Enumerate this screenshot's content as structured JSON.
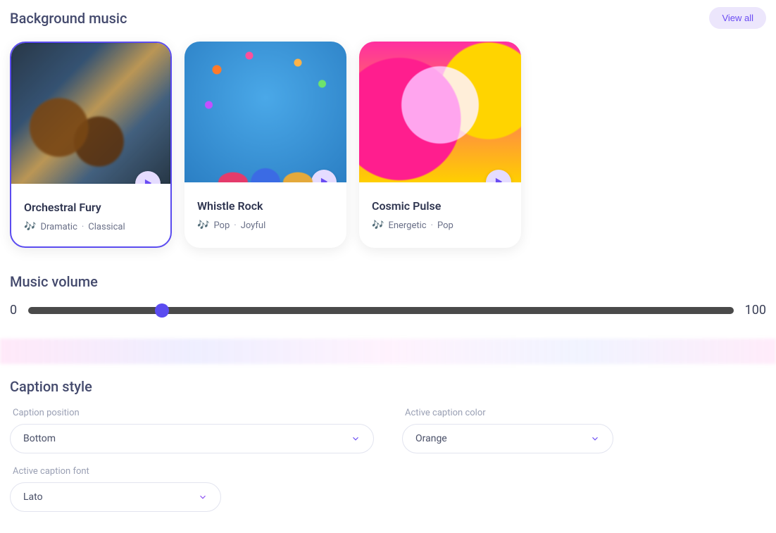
{
  "music": {
    "title": "Background music",
    "view_all": "View all",
    "cards": [
      {
        "title": "Orchestral Fury",
        "tag1": "Dramatic",
        "tag2": "Classical",
        "selected": true
      },
      {
        "title": "Whistle Rock",
        "tag1": "Pop",
        "tag2": "Joyful",
        "selected": false
      },
      {
        "title": "Cosmic Pulse",
        "tag1": "Energetic",
        "tag2": "Pop",
        "selected": false
      }
    ],
    "tag_icon": "🎶",
    "dot": "·"
  },
  "volume": {
    "title": "Music volume",
    "min": "0",
    "max": "100",
    "value": 19
  },
  "caption": {
    "title": "Caption style",
    "fields": {
      "position": {
        "label": "Caption position",
        "value": "Bottom"
      },
      "color": {
        "label": "Active caption color",
        "value": "Orange"
      },
      "font": {
        "label": "Active caption font",
        "value": "Lato"
      }
    }
  }
}
